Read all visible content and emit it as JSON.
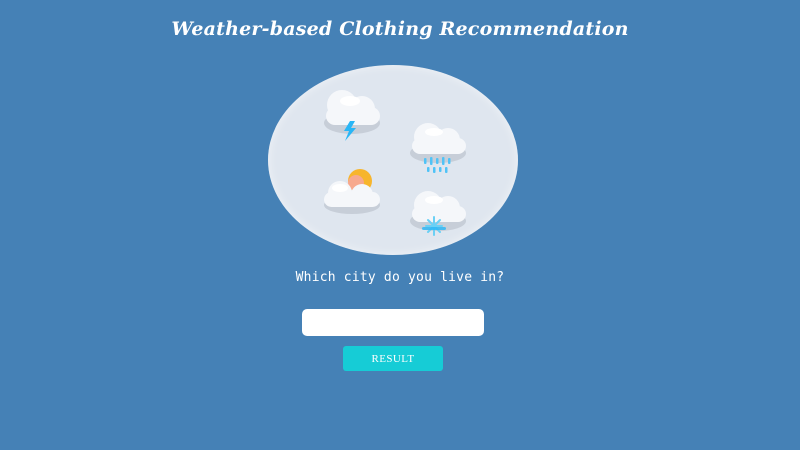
{
  "page": {
    "title": "Weather-based Clothing Recommendation"
  },
  "illustration": {
    "icons": [
      "thunderstorm-cloud-icon",
      "rain-cloud-icon",
      "partly-sunny-cloud-icon",
      "snow-cloud-icon"
    ]
  },
  "form": {
    "prompt": "Which city do you live in?",
    "city_value": "",
    "city_placeholder": "",
    "button_label": "RESULT"
  },
  "colors": {
    "background": "#4581b6",
    "illustration_bg": "#dfe6ef",
    "button": "#16ccd6",
    "input": "#ffffff",
    "rain": "#4fc3f7",
    "lightning": "#29b6f6",
    "sun": "#f7b52c",
    "snow": "#6ad0f5"
  }
}
